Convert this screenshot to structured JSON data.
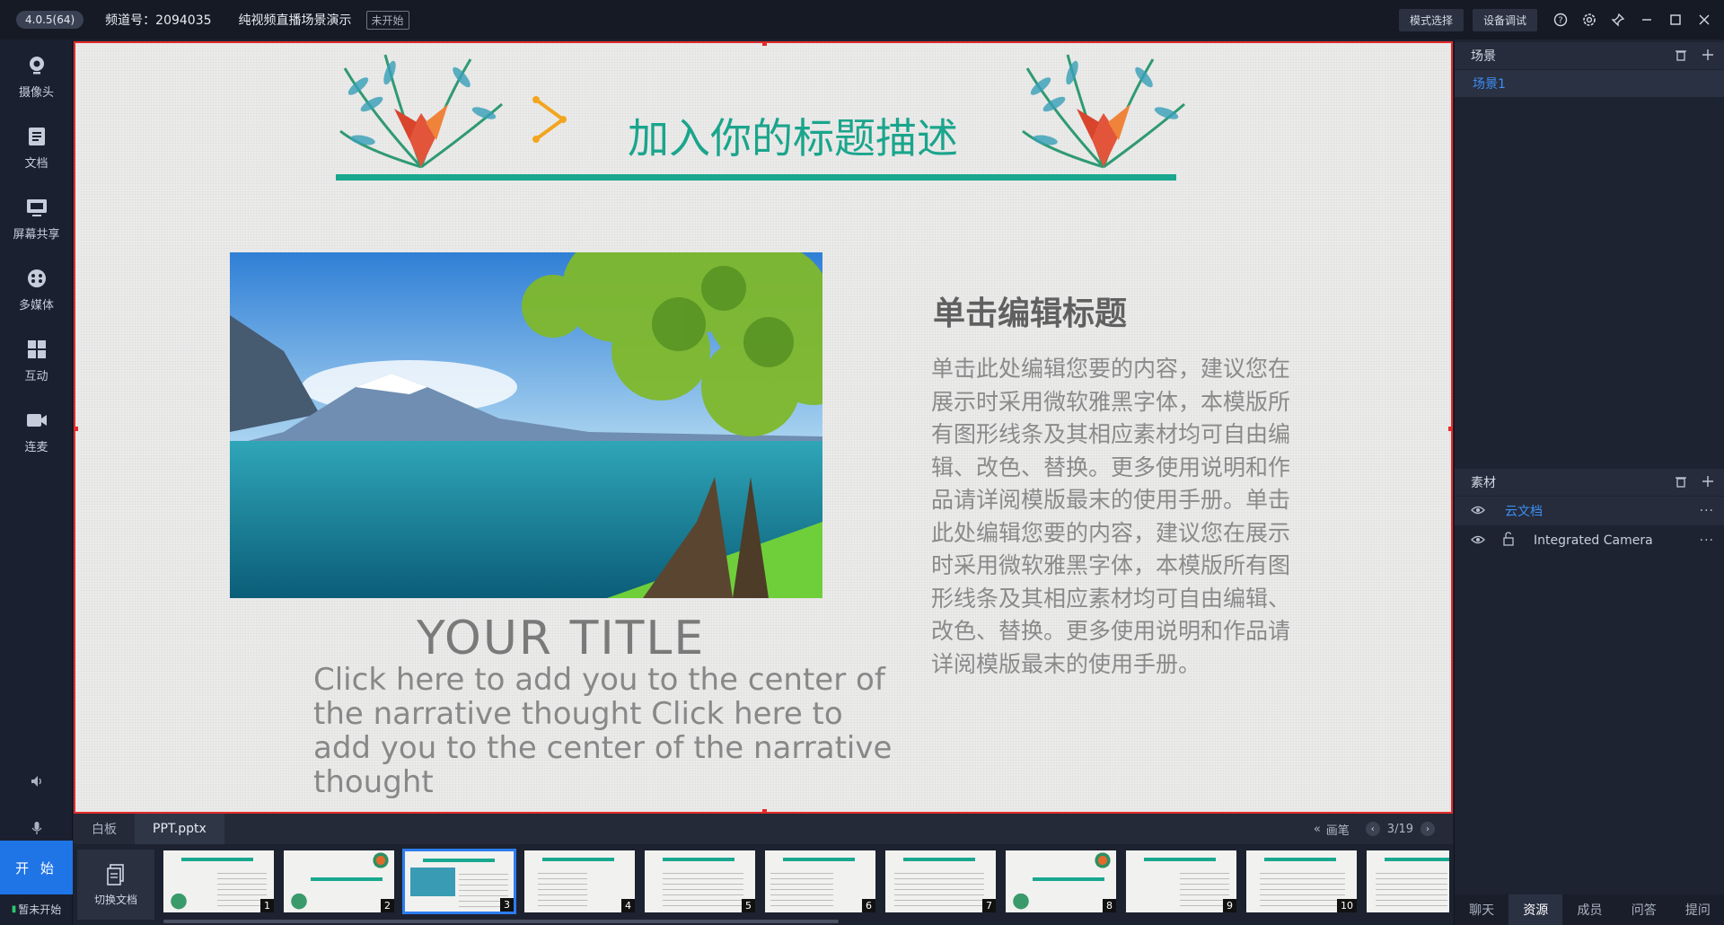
{
  "titlebar": {
    "version": "4.0.5(64)",
    "channel": "频道号：2094035",
    "live_name": "纯视频直播场景演示",
    "status": "未开始",
    "mode_btn": "模式选择",
    "device_btn": "设备调试",
    "icons": [
      "help-icon",
      "settings-icon",
      "pin-icon",
      "minimize-icon",
      "maximize-icon",
      "close-icon"
    ]
  },
  "sidebar": {
    "items": [
      {
        "label": "摄像头",
        "icon": "camera-icon"
      },
      {
        "label": "文档",
        "icon": "document-icon"
      },
      {
        "label": "屏幕共享",
        "icon": "screen-share-icon"
      },
      {
        "label": "多媒体",
        "icon": "multimedia-icon"
      },
      {
        "label": "互动",
        "icon": "interact-icon"
      },
      {
        "label": "连麦",
        "icon": "video-call-icon"
      }
    ],
    "start_label": "开 始",
    "status_label": "暂未开始"
  },
  "slide": {
    "title": "加入你的标题描述",
    "heading": "单击编辑标题",
    "body": "单击此处编辑您要的内容，建议您在展示时采用微软雅黑字体，本模版所有图形线条及其相应素材均可自由编辑、改色、替换。更多使用说明和作品请详阅模版最末的使用手册。单击此处编辑您要的内容，建议您在展示时采用微软雅黑字体，本模版所有图形线条及其相应素材均可自由编辑、改色、替换。更多使用说明和作品请详阅模版最末的使用手册。",
    "your_title": "YOUR  TITLE",
    "caption": "Click here to add you to the center of the narrative thought Click here to add you to the center of the narrative thought"
  },
  "doc_tabs": {
    "tabs": [
      "白板",
      "PPT.pptx"
    ],
    "pen_label": "画笔",
    "page": "3/19"
  },
  "thumbs": {
    "switch_label": "切换文档",
    "numbers": [
      "1",
      "2",
      "3",
      "4",
      "5",
      "6",
      "7",
      "8",
      "9",
      "10",
      ""
    ]
  },
  "right_panel": {
    "scene_header": "场景",
    "scene_item": "场景1",
    "material_header": "素材",
    "materials": [
      "云文档",
      "Integrated Camera"
    ],
    "bottom_tabs": [
      "聊天",
      "资源",
      "成员",
      "问答",
      "提问"
    ]
  },
  "colors": {
    "accent": "#1f74e6",
    "slide_green": "#19a88f",
    "selection_red": "#e52a2a"
  }
}
